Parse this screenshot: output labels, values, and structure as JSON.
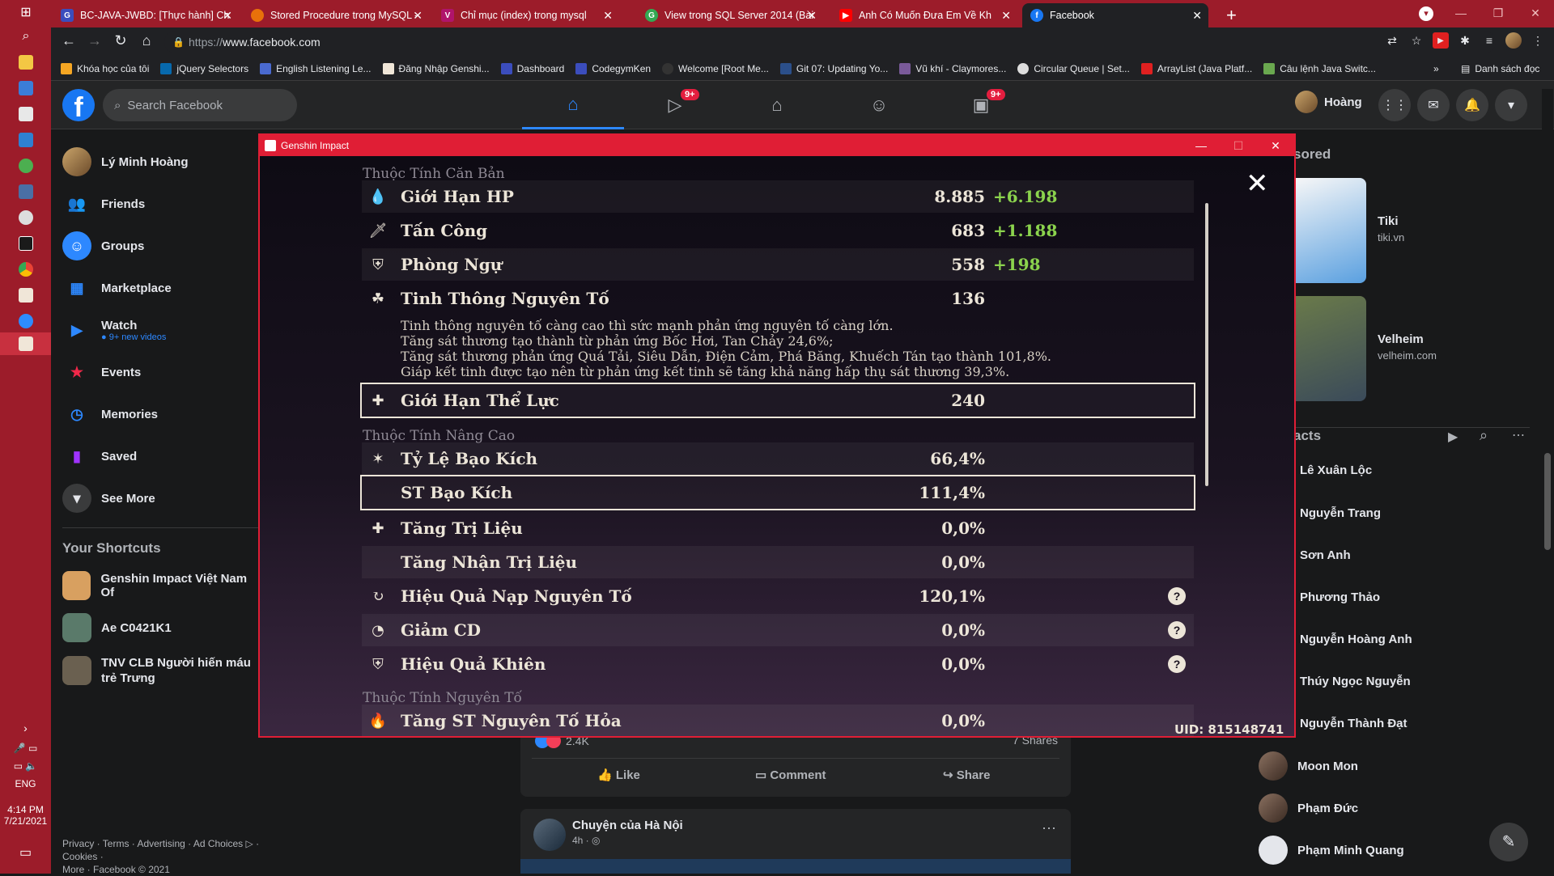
{
  "browser": {
    "tabs": [
      {
        "label": "BC-JAVA-JWBD: [Thực hành] Ch",
        "color": "#3b4dbd"
      },
      {
        "label": "Stored Procedure trong MySQL -",
        "color": "#e8710a"
      },
      {
        "label": "Chỉ mục (index) trong mysql",
        "color": "#b0146b"
      },
      {
        "label": "View trong SQL Server 2014 (Bài",
        "color": "#34a853"
      },
      {
        "label": "Anh Có Muốn Đưa Em Về Kh",
        "color": "#ff0000"
      },
      {
        "label": "Facebook",
        "color": "#1877f2"
      }
    ],
    "url_scheme": "https://",
    "url_host": "www.facebook.com",
    "bookmarks": [
      "Khóa học của tôi",
      "jQuery Selectors",
      "English Listening Le...",
      "Đăng Nhập Genshi...",
      "Dashboard",
      "CodegymKen",
      "Welcome [Root Me...",
      "Git 07: Updating Yo...",
      "Vũ khí - Claymores...",
      "Circular Queue | Set...",
      "ArrayList (Java Platf...",
      "Câu lệnh Java Switc..."
    ],
    "reading_list": "Danh sách đọc"
  },
  "taskbar": {
    "lang": "ENG",
    "time": "4:14 PM",
    "date": "7/21/2021"
  },
  "facebook": {
    "search_placeholder": "Search Facebook",
    "badge_watch": "9+",
    "badge_gaming": "9+",
    "profile_name": "Hoàng",
    "left_items": [
      {
        "label": "Lý Minh Hoàng"
      },
      {
        "label": "Friends"
      },
      {
        "label": "Groups"
      },
      {
        "label": "Marketplace"
      },
      {
        "label": "Watch",
        "sub": "● 9+ new videos"
      },
      {
        "label": "Events"
      },
      {
        "label": "Memories"
      },
      {
        "label": "Saved"
      },
      {
        "label": "See More"
      }
    ],
    "shortcuts_title": "Your Shortcuts",
    "shortcuts": [
      "Genshin Impact Việt Nam Of",
      "Ae C0421K1",
      "TNV CLB Người hiến máu trẻ Trưng"
    ],
    "footer_line1": "Privacy · Terms · Advertising · Ad Choices ▷ · Cookies ·",
    "footer_line2": "More · Facebook © 2021",
    "sponsored_title": "sored",
    "sponsors": [
      {
        "name": "Tiki",
        "domain": "tiki.vn"
      },
      {
        "name": "Velheim",
        "domain": "velheim.com"
      }
    ],
    "contacts_title": "acts",
    "contacts": [
      "Lê Xuân Lộc",
      "Nguyễn Trang",
      "Sơn Anh",
      "Phương Thảo",
      "Nguyễn Hoàng Anh",
      "Thúy Ngọc Nguyễn",
      "Nguyễn Thành Đạt",
      "Moon Mon",
      "Phạm Đức",
      "Phạm Minh Quang"
    ],
    "post": {
      "reactions": "2.4K",
      "shares": "7 Shares",
      "like": "Like",
      "comment": "Comment",
      "share": "Share"
    },
    "post2": {
      "author": "Chuyện của Hà Nội",
      "time": "4h ·"
    }
  },
  "genshin": {
    "window_title": "Genshin Impact",
    "section_base": "Thuộc Tính Căn Bản",
    "section_advanced": "Thuộc Tính Nâng Cao",
    "section_elemental": "Thuộc Tính Nguyên Tố",
    "base_rows": [
      {
        "label": "Giới Hạn HP",
        "value": "8.885",
        "bonus": "+6.198",
        "icon": "hp-icon"
      },
      {
        "label": "Tấn Công",
        "value": "683",
        "bonus": "+1.188",
        "icon": "attack-icon"
      },
      {
        "label": "Phòng Ngự",
        "value": "558",
        "bonus": "+198",
        "icon": "defense-icon"
      },
      {
        "label": "Tinh Thông Nguyên Tố",
        "value": "136",
        "bonus": "",
        "icon": "elemental-mastery-icon"
      }
    ],
    "em_description": [
      "Tinh thông nguyên tố càng cao thì sức mạnh phản ứng nguyên tố càng lớn.",
      "Tăng sát thương tạo thành từ phản ứng Bốc Hơi, Tan Chảy 24,6%;",
      "Tăng sát thương phản ứng Quá Tải, Siêu Dẫn, Điện Cảm, Phá Băng, Khuếch Tán tạo thành 101,8%.",
      "Giáp kết tinh được tạo nên từ phản ứng kết tinh sẽ tăng khả năng hấp thụ sát thương 39,3%."
    ],
    "stamina": {
      "label": "Giới Hạn Thể Lực",
      "value": "240"
    },
    "advanced_rows": [
      {
        "label": "Tỷ Lệ Bạo Kích",
        "value": "66,4%"
      },
      {
        "label": "ST Bạo Kích",
        "value": "111,4%"
      },
      {
        "label": "Tăng Trị Liệu",
        "value": "0,0%"
      },
      {
        "label": "Tăng Nhận Trị Liệu",
        "value": "0,0%"
      },
      {
        "label": "Hiệu Quả Nạp Nguyên Tố",
        "value": "120,1%"
      },
      {
        "label": "Giảm CD",
        "value": "0,0%"
      },
      {
        "label": "Hiệu Quả Khiên",
        "value": "0,0%"
      }
    ],
    "elemental_rows": [
      {
        "label": "Tăng ST Nguyên Tố Hỏa",
        "value": "0,0%"
      }
    ],
    "help": "?",
    "uid": "UID: 815148741"
  }
}
